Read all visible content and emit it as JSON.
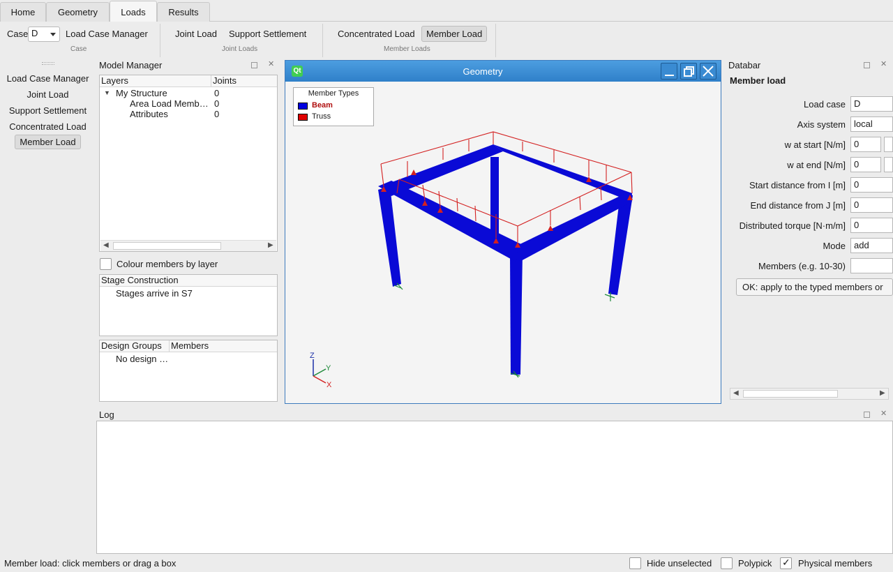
{
  "tabs": [
    "Home",
    "Geometry",
    "Loads",
    "Results"
  ],
  "ribbon": {
    "case_label": "Case",
    "case_value": "D",
    "load_case_manager": "Load Case Manager",
    "group_case": "Case",
    "joint_load": "Joint Load",
    "support_settlement": "Support Settlement",
    "group_joint": "Joint Loads",
    "concentrated_load": "Concentrated Load",
    "member_load": "Member Load",
    "group_member": "Member Loads"
  },
  "left_bar": {
    "items": [
      "Load Case Manager",
      "Joint Load",
      "Support Settlement",
      "Concentrated Load",
      "Member Load"
    ]
  },
  "model_manager": {
    "title": "Model Manager",
    "col_layers": "Layers",
    "col_joints": "Joints",
    "rows": [
      {
        "name": "My Structure",
        "joints": "0"
      },
      {
        "name": "Area Load Memb…",
        "joints": "0"
      },
      {
        "name": "Attributes",
        "joints": "0"
      }
    ],
    "colour_by_layer": "Colour members by layer",
    "stage_header": "Stage Construction",
    "stage_text": "Stages arrive in S7",
    "design_groups": "Design Groups",
    "members_col": "Members",
    "design_text": "No design …"
  },
  "geometry": {
    "title": "Geometry",
    "legend_title": "Member Types",
    "legend": [
      {
        "name": "Beam",
        "color": "#0000e0"
      },
      {
        "name": "Truss",
        "color": "#e00000"
      }
    ],
    "axis_z": "Z",
    "axis_y": "Y",
    "axis_x": "X",
    "beam_color": "#0a0ad6",
    "load_color": "#d32020",
    "support_color": "#1f8a3a"
  },
  "databar": {
    "title": "Databar",
    "heading": "Member load",
    "load_case_label": "Load case",
    "load_case_value": "D",
    "axis_label": "Axis system",
    "axis_value": "local",
    "w_start_label": "w at start [N/m]",
    "w_start_value": "0",
    "w_end_label": "w at end [N/m]",
    "w_end_value": "0",
    "start_dist_label": "Start distance from I [m]",
    "start_dist_value": "0",
    "end_dist_label": "End distance from J [m]",
    "end_dist_value": "0",
    "torque_label": "Distributed torque [N·m/m]",
    "torque_value": "0",
    "mode_label": "Mode",
    "mode_value": "add",
    "members_label": "Members (e.g. 10-30)",
    "members_value": "",
    "ok_button": "OK: apply to the typed members or"
  },
  "log": {
    "title": "Log"
  },
  "status": {
    "message": "Member load: click members or drag a box",
    "hide_unselected": "Hide unselected",
    "polypick": "Polypick",
    "physical_members": "Physical members"
  }
}
